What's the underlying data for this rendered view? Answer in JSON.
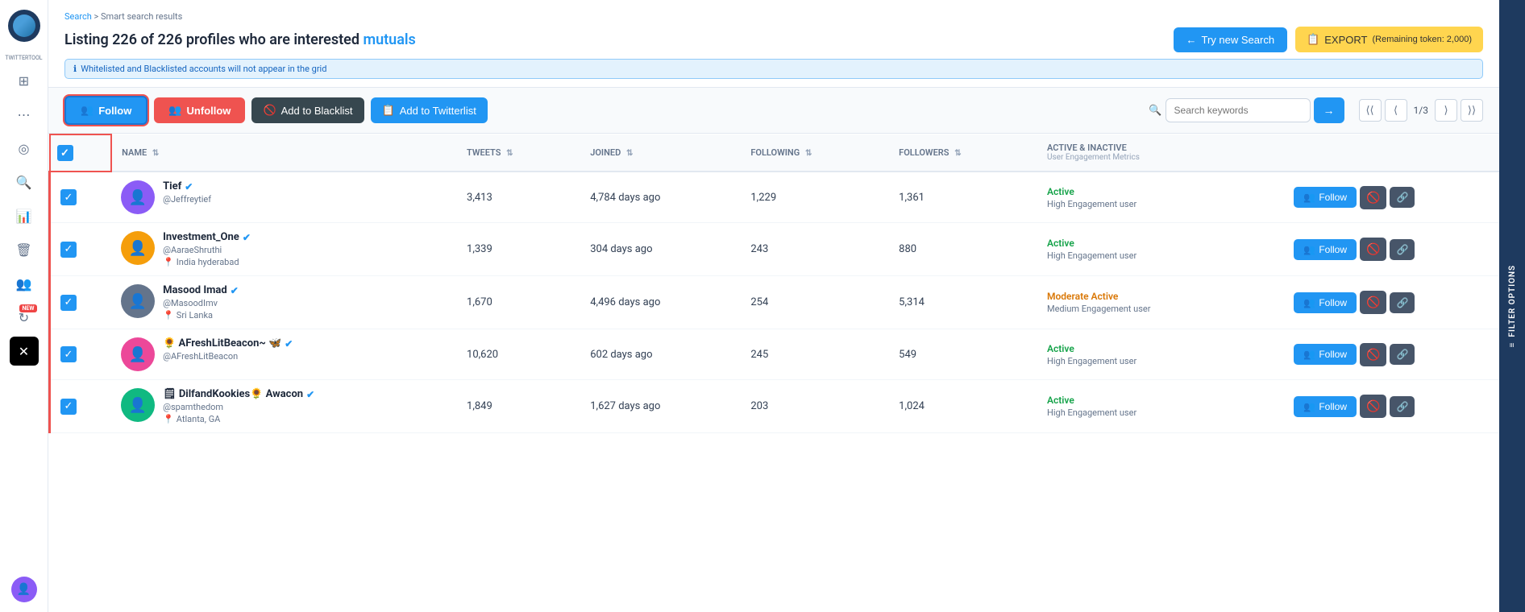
{
  "app": {
    "name": "TWITTERTOOL"
  },
  "breadcrumb": {
    "parent": "Search",
    "current": "Smart search results"
  },
  "header": {
    "title": "Listing 226 of 226 profiles who are interested",
    "highlight": "mutuals",
    "info_text": "Whitelisted and Blacklisted accounts will not appear in the grid",
    "btn_try_search": "Try new Search",
    "btn_export": "EXPORT",
    "export_note": "(Remaining token: 2,000)"
  },
  "toolbar": {
    "btn_follow": "Follow",
    "btn_unfollow": "Unfollow",
    "btn_blacklist": "Add to Blacklist",
    "btn_twitterlist": "Add to Twitterlist",
    "search_placeholder": "Search keywords",
    "page_current": "1",
    "page_total": "3"
  },
  "table": {
    "headers": {
      "name": "NAME",
      "tweets": "TWEETS",
      "joined": "JOINED",
      "following": "FOLLOWING",
      "followers": "FOLLOWERS",
      "active": "ACTIVE & INACTIVE",
      "active_sub": "User Engagement Metrics"
    },
    "rows": [
      {
        "id": 1,
        "name": "Tief",
        "verified": true,
        "handle": "@Jeffreytief",
        "location": "",
        "tweets": "3,413",
        "joined": "4,784 days ago",
        "following": "1,229",
        "followers": "1,361",
        "status": "Active",
        "status_type": "active",
        "engagement": "High Engagement user",
        "avatar_emoji": "👤",
        "avatar_bg": "#8b5cf6"
      },
      {
        "id": 2,
        "name": "Investment_One",
        "verified": true,
        "handle": "@AaraeShruthi",
        "location": "India hyderabad",
        "tweets": "1,339",
        "joined": "304 days ago",
        "following": "243",
        "followers": "880",
        "status": "Active",
        "status_type": "active",
        "engagement": "High Engagement user",
        "avatar_emoji": "👤",
        "avatar_bg": "#f59e0b"
      },
      {
        "id": 3,
        "name": "Masood Imad",
        "verified": true,
        "handle": "@MasoodImv",
        "location": "Sri Lanka",
        "tweets": "1,670",
        "joined": "4,496 days ago",
        "following": "254",
        "followers": "5,314",
        "status": "Moderate Active",
        "status_type": "moderate",
        "engagement": "Medium Engagement user",
        "avatar_emoji": "👤",
        "avatar_bg": "#64748b"
      },
      {
        "id": 4,
        "name": "🌻 AFreshLitBeacon~ 🦋",
        "verified": true,
        "handle": "@AFreshLitBeacon",
        "location": "",
        "tweets": "10,620",
        "joined": "602 days ago",
        "following": "245",
        "followers": "549",
        "status": "Active",
        "status_type": "active",
        "engagement": "High Engagement user",
        "avatar_emoji": "👤",
        "avatar_bg": "#ec4899"
      },
      {
        "id": 5,
        "name": "🗒 DilfandKookies🌻 Awacon",
        "verified": true,
        "handle": "@spamthedom",
        "location": "Atlanta, GA",
        "tweets": "1,849",
        "joined": "1,627 days ago",
        "following": "203",
        "followers": "1,024",
        "status": "Active",
        "status_type": "active",
        "engagement": "High Engagement user",
        "avatar_emoji": "👤",
        "avatar_bg": "#10b981"
      }
    ]
  },
  "sidebar": {
    "icons": [
      {
        "name": "grid-icon",
        "symbol": "⊞",
        "active": false
      },
      {
        "name": "network-icon",
        "symbol": "⋮⋮",
        "active": false
      },
      {
        "name": "target-icon",
        "symbol": "◎",
        "active": false
      },
      {
        "name": "search-icon",
        "symbol": "⌕",
        "active": false
      },
      {
        "name": "chart-icon",
        "symbol": "▦",
        "active": false
      },
      {
        "name": "trash-icon",
        "symbol": "🗑",
        "active": false
      },
      {
        "name": "users-icon",
        "symbol": "👥",
        "active": false
      },
      {
        "name": "refresh-icon",
        "symbol": "↻",
        "active": false
      },
      {
        "name": "twitter-icon",
        "symbol": "✕",
        "active": false
      }
    ]
  },
  "filter_sidebar": {
    "label": "FILTER OPTIONS"
  }
}
